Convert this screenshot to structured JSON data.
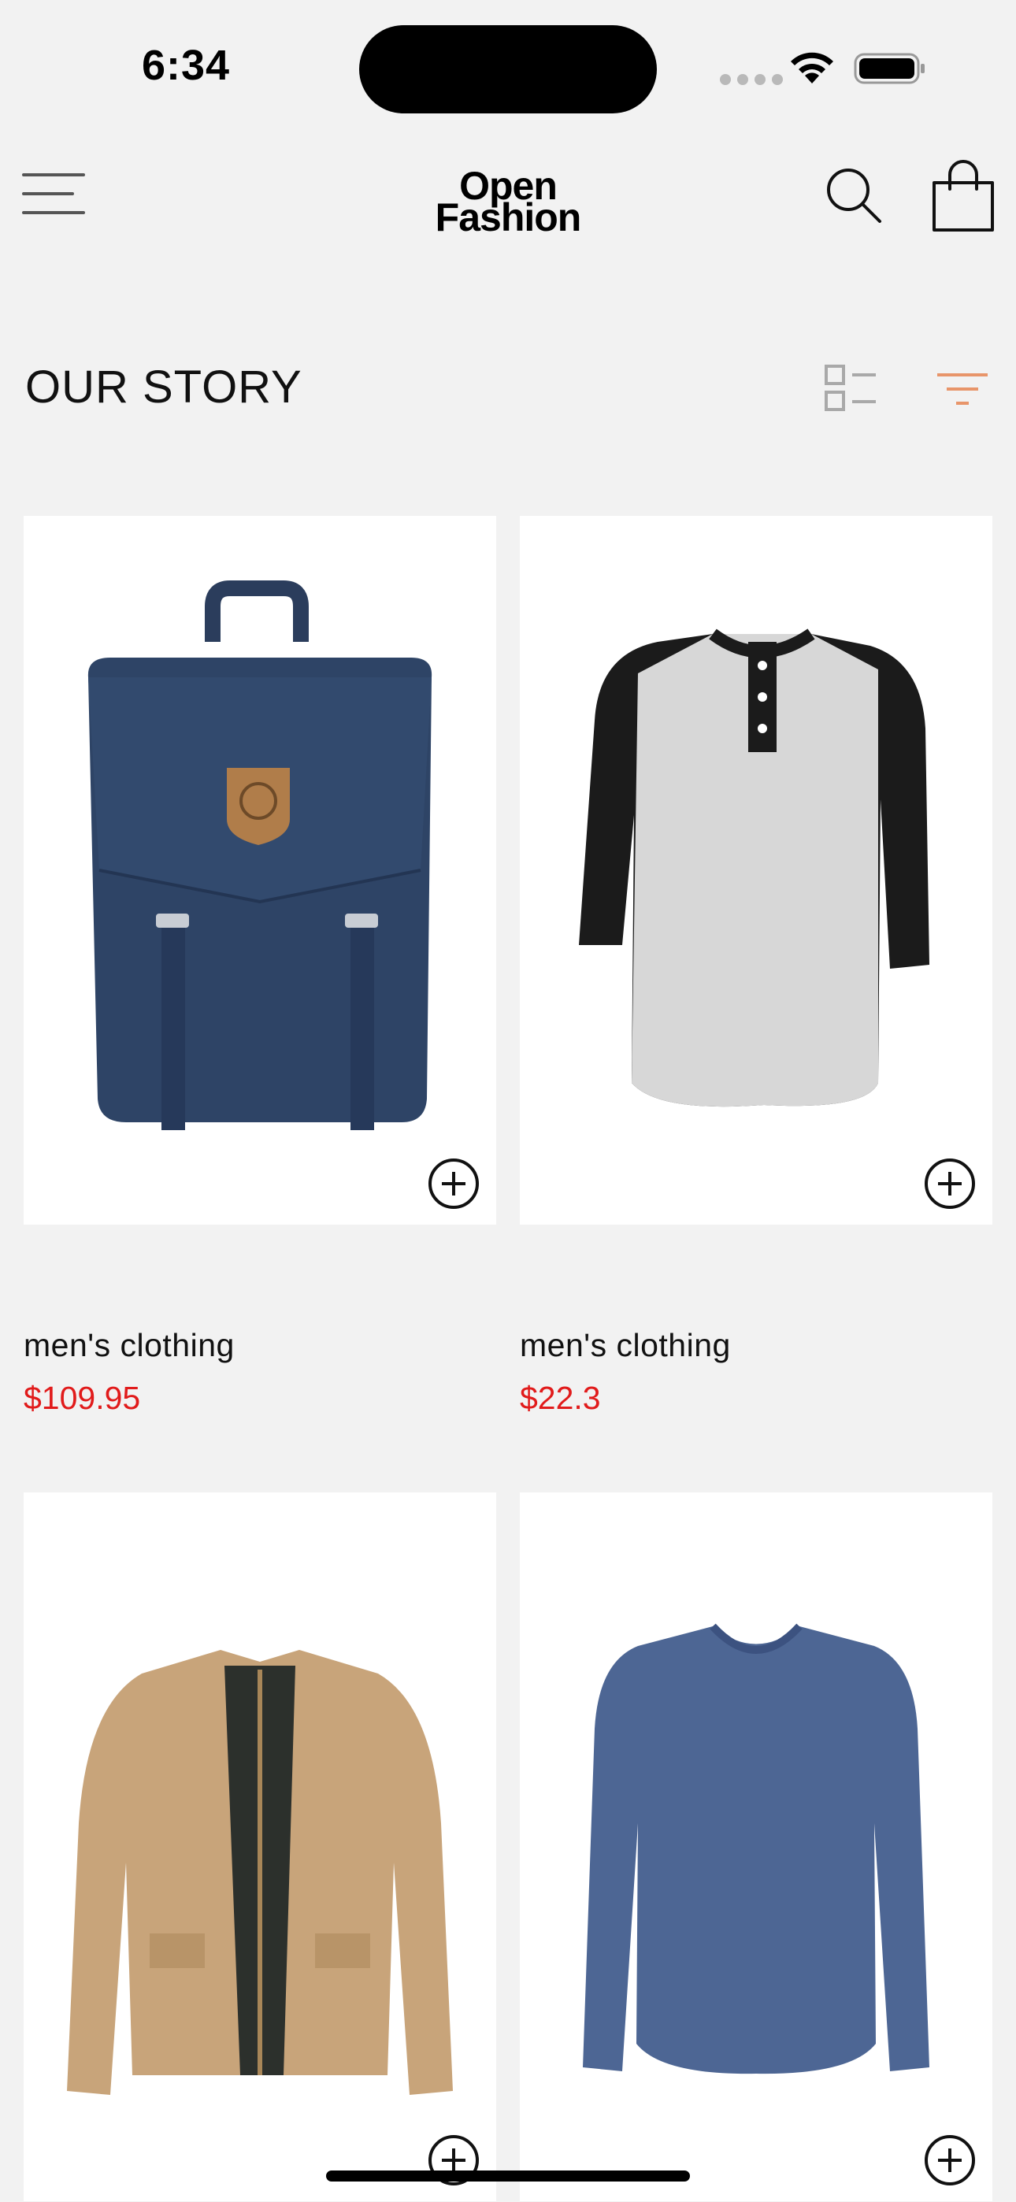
{
  "status_bar": {
    "time": "6:34"
  },
  "header": {
    "brand_line1": "Open",
    "brand_line2": "Fashion",
    "icons": [
      "menu-icon",
      "search-icon",
      "shopping-bag-icon"
    ]
  },
  "section": {
    "title": "OUR STORY",
    "icons": [
      "list-view-icon",
      "filter-icon"
    ]
  },
  "products": [
    {
      "category": "men's clothing",
      "price": "$109.95",
      "image": "navy-backpack"
    },
    {
      "category": "men's clothing",
      "price": "$22.3",
      "image": "raglan-henley-shirt"
    },
    {
      "category": "",
      "price": "",
      "image": "khaki-jacket"
    },
    {
      "category": "",
      "price": "",
      "image": "blue-long-sleeve-tee"
    }
  ],
  "colors": {
    "background": "#f2f2f2",
    "price": "#e11b1b",
    "filter_accent": "#e8956a",
    "text": "#111111"
  }
}
